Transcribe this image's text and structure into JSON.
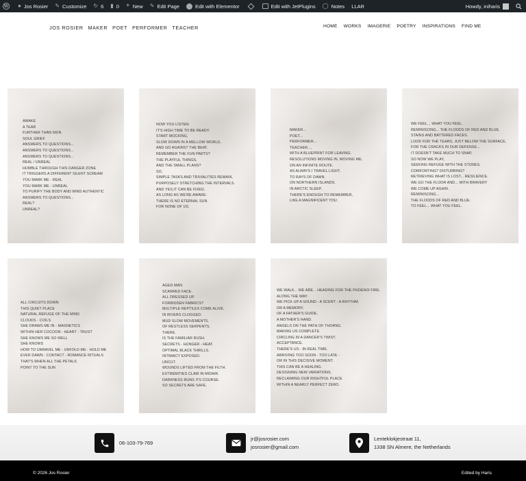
{
  "adminbar": {
    "site_name": "Jos Rosier",
    "customize": "Customize",
    "updates_count": "6",
    "comments_count": "0",
    "new": "New",
    "edit_page": "Edit Page",
    "edit_elementor": "Edit with Elementor",
    "edit_jetplugins": "Edit with JetPlugins",
    "notes": "Notes",
    "llar": "LLAR",
    "howdy": "Howdy, iniharis"
  },
  "header": {
    "brand": [
      "JOS ROSIER",
      "MAKER",
      "POET",
      "PERFORMER",
      "TEACHER"
    ],
    "nav": [
      "HOME",
      "WORKS",
      "IMAGERIE",
      "POETRY",
      "INSPIRATIONS",
      "FIND ME"
    ]
  },
  "poems": [
    [
      "AWAKE",
      "A TEAR",
      "FURTHER THAN SKIN",
      "SOUL GRIEF",
      "ANSWERS TO QUESTIONS...",
      "ANSWERS TO QUESTIONS...",
      "ANSWERS TO QUESTIONS...",
      "REAL / UNREAL",
      "HUMBLE THROUGH THIS DANGER ZONE",
      "IT TRIGGERS A DIFFERENT SILENT SCREAM",
      "YOU MARK ME - REAL",
      "YOU MARK ME - UNREAL",
      "TO PURIFY THE BODY AND MIND AUTHENTIC",
      "ANSWERS TO QUESTIONS...",
      "REAL?",
      "UNREAL?"
    ],
    [
      "NOW YOU LISTEN:",
      "IT'S HIGH TIME TO BE READY.",
      "START MOCKING,",
      "SLOW DOWN IN A MELLOW WORLD,",
      "AND GO AGAINST THE BEAT.",
      "REMEMBER THE FUN PARTS?",
      "THE PLAYFUL THINGS,",
      "AND THE SMALL PLANS?",
      "SO,",
      "SIMPLE TASKS AND TRIVIALITIES REMAIN,",
      "PURPOSELY STRETCHING THE INTERVALS.",
      "AND YES,IT CAN BE FIXED,",
      "AS LONG AS WE'RE AWARE:",
      "THERE IS NO ETERNAL SUN.",
      "FOR NONE OF US."
    ],
    [
      "MAKER...",
      "POET...",
      "PERFORMER...",
      "TEACHER...,",
      "WITH A BLUEPRINT FOR LEAVING.",
      "RESOLUTIONS MOVING IN, MOVING ME,",
      "ON AN INFINITE ROUTE.",
      "AS ALWAYS I TRAVEL LIGHT,",
      "TO RAYS OF DAWN,",
      "ON NORTHERN ISLANDS.",
      "IN ARCTIC SLEEP,",
      "THERE'S ENOUGH TO REMEMBER,",
      "LIKE A MAGNIFICENT YOU."
    ],
    [
      "WE FEEL... WHAT YOU FEEL.",
      "REMINISCING... THE FLOODS OF RED AND BLUE.",
      "STAINS AND BATTERED FACES.",
      "LOOK FOR THE TEARS, JUST BELOW THE SURFACE,",
      "FOR THE CRACKS IN OUR DEFENSE...",
      "IT DOESN'T TAKE MUCH TO SNAP,",
      "SO NOW WE PLAY,",
      "SEEKING REFUGE WITH THE STONES.",
      "COMFORTING? DISTURBING?",
      "RETRIEVING WHAT IS LOST... RESILIENCE.",
      "WE GO THE FLOOR AND... WITH BRAVERY",
      "WE COME UP AGAIN.",
      "REMINISCING...",
      "THE FLOODS OF RED AND BLUE.",
      "TO FEEL... WHAT YOU FEEL."
    ],
    [
      "ALL CIRCUITS DOWN",
      "THIS QUIET PLACE",
      "NATURAL REFUGE OF THE MIND",
      "CLOUDS - COILS",
      "SHE DRAWS ME IN - MAGNETICS",
      "WITHIN HER COCOON - HEART - TRUST",
      "SHE KNOWS ME SO WELL",
      "SHE KNOWS",
      "HOW TO UNRAVEL ME - UNFOLD ME - HOLD ME",
      "EVER DAWN - CONTACT - ROMANCE RITUALS",
      "THAT'S WHEN ALL THE PETALS",
      "POINT TO THE SUN"
    ],
    [
      "AGED MAN.",
      "SCARRED FACE.",
      "ALL DRESSED UP.",
      "FORBIDDEN FABRICS?",
      "MULTIPLE REPTILES COME ALIVE.",
      "IN RIVERS CLOGGED.",
      "MUD SLOW MOVEMENTS.",
      "OF RESTLESS SERPENTS.",
      "THERE.",
      "IS THE FAMILIAR RUSH.",
      "SECRETS - HUNGER - HEAT.",
      "OPTIMAL BLACK THRILLS.",
      "INTIMACY EXPOSED.",
      "UNCUT.",
      "WOUNDS LIFTED FROM THE FILTH.",
      "EXTREMITIES CLAW IN MIDAIR.",
      "DARKNESS RUNS ITS COURSE.",
      "SO SECRETS ARE SAFE."
    ],
    [
      "WE WALK... WE ARE... HEADING FOR THE PHOENIX FIRE.",
      "ALONG THE WAY.",
      "WE PICK UP A SOUND - A SCENT - A RHYTHM.",
      "OR A MEMORY,",
      "OF A FATHER'S GUIDE.",
      "A MOTHER'S HAND.",
      "ANGELS ON THE PATH OF THORNS.",
      "MAKING US COMPLETE.",
      "CIRCLING IN A DANCER'S TWIST.",
      "ACCEPTANCE.",
      "THERE'S US - IN REAL TIME.",
      "ARRIVING TOO SOON - TOO LATE -",
      "OR IN THIS DECISIVE MOMENT.",
      "THIS CAN BE A HEALING.",
      "DESIGNING NEW VARIATIONS.",
      "RECLAIMING OUR RIGHTFUL PLACE",
      "WITHIN A NEARLY PERFECT ZERO."
    ]
  ],
  "contact": {
    "phone": "06-103-79-769",
    "email_1": "jr@josrosier.com",
    "email_2": "josrosier@gmail.com",
    "address_1": "Lenteklokjestraat 11,",
    "address_2": "1338 SN Almere, the Netherlands"
  },
  "footer": {
    "copyright": "© 2026 Jos Rosier",
    "credit": "Edited by Haris"
  }
}
